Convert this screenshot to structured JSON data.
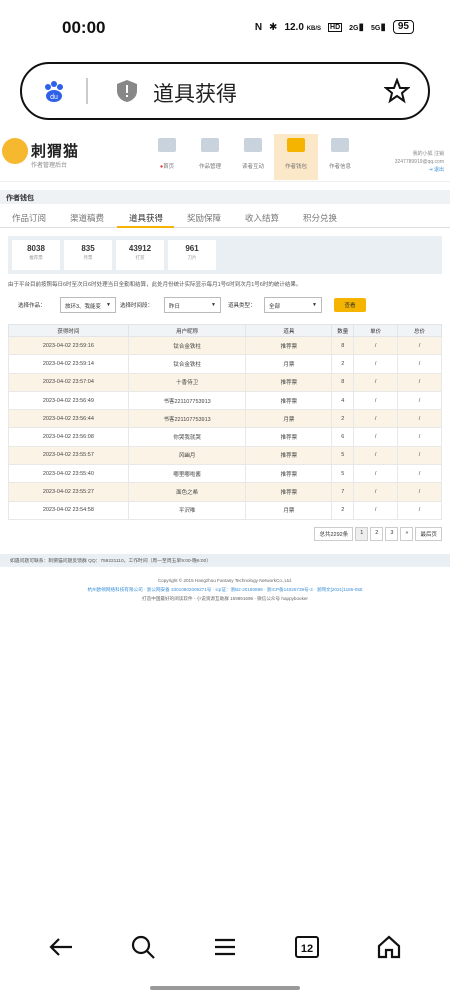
{
  "status_bar": {
    "time": "00:00",
    "speed": "12.0",
    "speed_unit": "KB/S",
    "hd": "HD",
    "net1": "2G",
    "net2": "5G",
    "battery": "95"
  },
  "address_bar": {
    "title": "道具获得"
  },
  "site": {
    "logo_text": "刺猬猫",
    "logo_sub": "作者管理后台",
    "nav": [
      {
        "label": "首页",
        "dot": "●"
      },
      {
        "label": "作品管理"
      },
      {
        "label": "读者互动"
      },
      {
        "label": "作者钱包"
      },
      {
        "label": "作者信息"
      }
    ],
    "user_line1": "我的小狐 注销",
    "user_line2": "3247789919@qq.com",
    "logout": "退出"
  },
  "section_title": "作者钱包",
  "tabs": [
    "作品订阅",
    "渠道稿费",
    "道具获得",
    "奖励保障",
    "收入结算",
    "积分兑换"
  ],
  "stats": [
    {
      "num": "8038",
      "cap": "推荐票"
    },
    {
      "num": "835",
      "cap": "月票"
    },
    {
      "num": "43912",
      "cap": "打赏"
    },
    {
      "num": "961",
      "cap": "刀片"
    }
  ],
  "notice": "由于平台目前按照每日6时至次日6时处理当日全勤和结算，此处月份统计实际显示每月1号6时到次月1号6时的统计结果。",
  "filters": {
    "work_label": "选择作品：",
    "work_value": "旅环3、我能变",
    "period_label": "选择时间段：",
    "period_value": "昨日",
    "type_label": "道具类型：",
    "type_value": "全部",
    "query": "查看"
  },
  "table": {
    "headers": [
      "获得时间",
      "用户昵称",
      "道具",
      "数量",
      "单价",
      "总价"
    ],
    "rows": [
      [
        "2023-04-02 23:59:16",
        "钛合金铁柱",
        "推荐票",
        "8",
        "/",
        "/"
      ],
      [
        "2023-04-02 23:59:14",
        "钛合金铁柱",
        "月票",
        "2",
        "/",
        "/"
      ],
      [
        "2023-04-02 23:57:04",
        "十香侍卫",
        "推荐票",
        "8",
        "/",
        "/"
      ],
      [
        "2023-04-02 23:56:49",
        "书客221107753913",
        "推荐票",
        "4",
        "/",
        "/"
      ],
      [
        "2023-04-02 23:56:44",
        "书客221107753913",
        "月票",
        "2",
        "/",
        "/"
      ],
      [
        "2023-04-02 23:56:08",
        "你哭我就哭",
        "推荐票",
        "6",
        "/",
        "/"
      ],
      [
        "2023-04-02 23:55:57",
        "风幽月",
        "推荐票",
        "5",
        "/",
        "/"
      ],
      [
        "2023-04-02 23:55:40",
        "嘟里嘟啦酱",
        "推荐票",
        "5",
        "/",
        "/"
      ],
      [
        "2023-04-02 23:55:27",
        "面色之希",
        "推荐票",
        "7",
        "/",
        "/"
      ],
      [
        "2023-04-02 23:54:58",
        "平沢唯",
        "月票",
        "2",
        "/",
        "/"
      ]
    ]
  },
  "pager": {
    "total": "总共2292条",
    "pages": [
      "1",
      "2",
      "3"
    ],
    "next": "»",
    "last": "最后页"
  },
  "contact": "如遇问题可联系：刺猬猫问题反馈群 QQ：759221110，工作时间（周一至周五早9:00-晚6:00）",
  "footer": {
    "line1": "Copyright © 2015 Hangzhou Fantasy Technology NetworkCo.,Ltd.",
    "line2": "杭州欧顿网络科技有限公司 · 浙公网安备 33010802009271号 · icp证：浙B2-20180899 · 浙ICP备14025739号-3 · 浙网文[2021]1185-055",
    "line3": "打造中国最好的阅读软件 - 小说资源互助群 159891696 · 微信公众号 happybooker"
  }
}
